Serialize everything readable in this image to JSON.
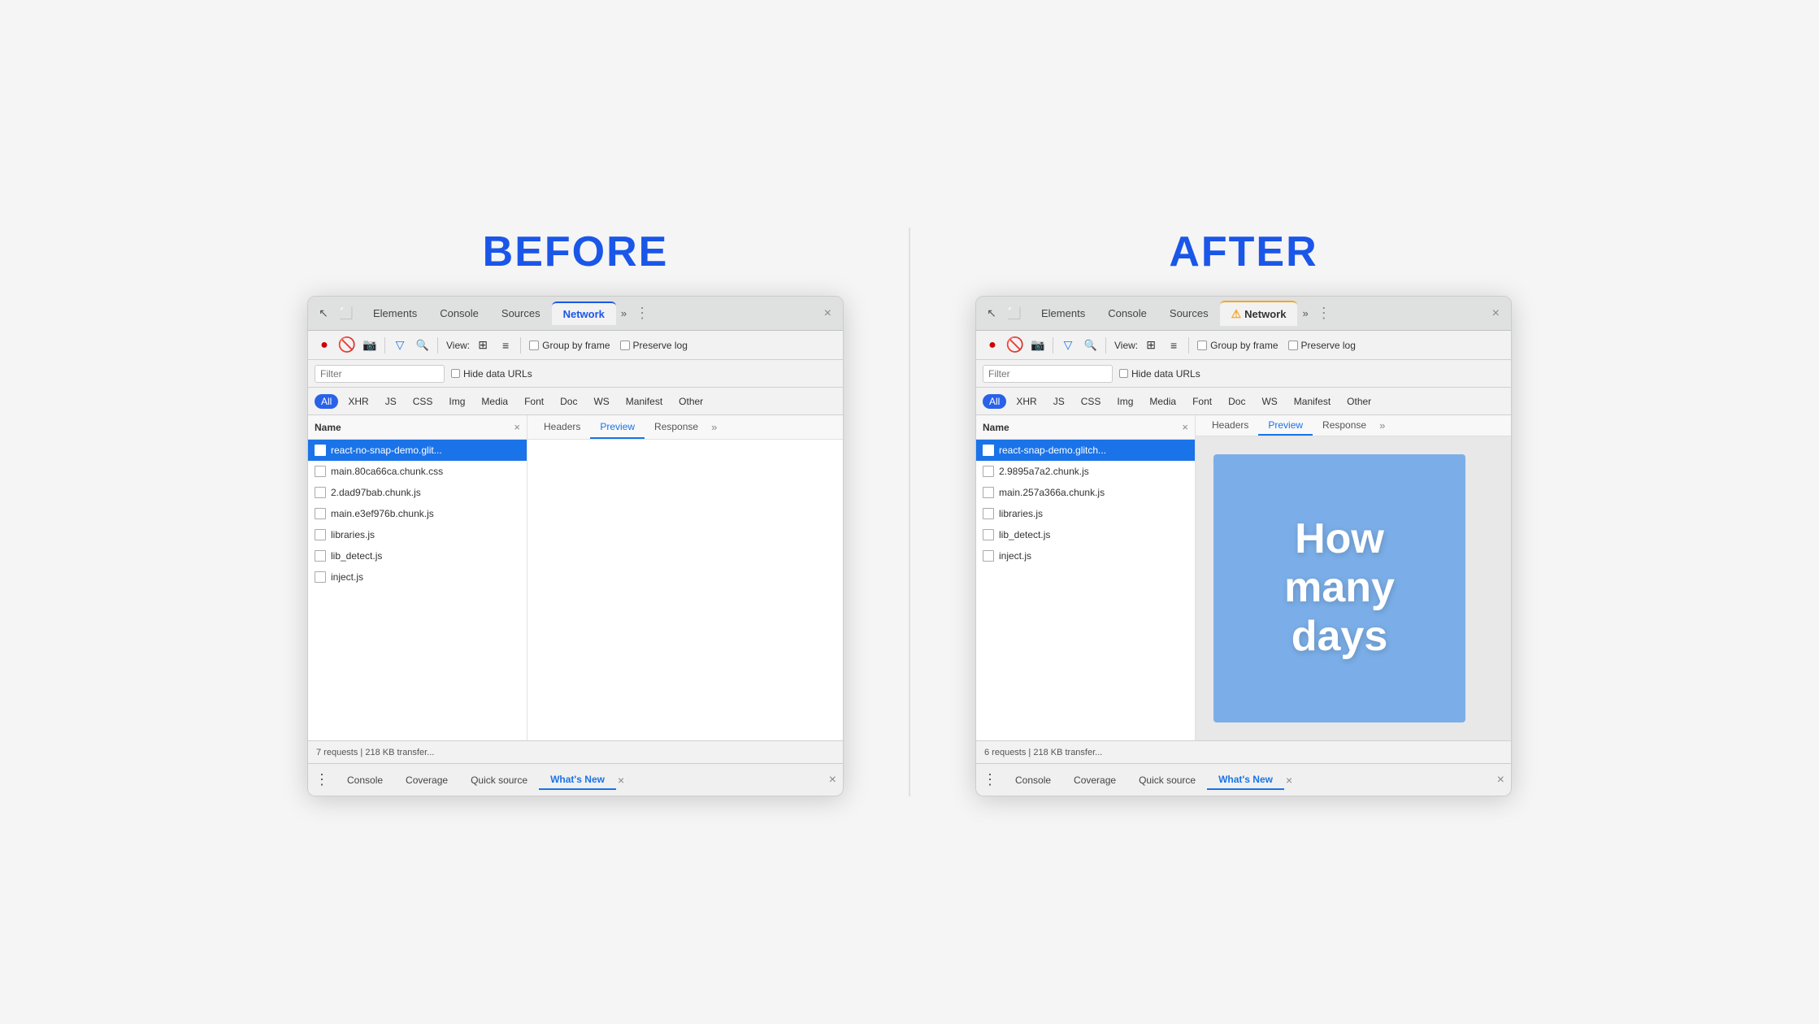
{
  "before": {
    "label": "BEFORE",
    "tabs": [
      "Elements",
      "Console",
      "Sources",
      "Network",
      "»"
    ],
    "active_tab": "Network",
    "active_tab_has_warning": false,
    "toolbar": {
      "view_label": "View:",
      "group_by_frame_label": "Group by frame",
      "preserve_log_label": "Preserve log"
    },
    "filter_placeholder": "Filter",
    "hide_data_urls": "Hide data URLs",
    "type_filters": [
      "All",
      "XHR",
      "JS",
      "CSS",
      "Img",
      "Media",
      "Font",
      "Doc",
      "WS",
      "Manifest",
      "Other"
    ],
    "active_type": "All",
    "columns": {
      "name": "Name",
      "close": "×"
    },
    "detail_tabs": [
      "Headers",
      "Preview",
      "Response",
      "»"
    ],
    "active_detail_tab": "Preview",
    "files": [
      {
        "name": "react-no-snap-demo.glit...",
        "selected": true
      },
      {
        "name": "main.80ca66ca.chunk.css",
        "selected": false
      },
      {
        "name": "2.dad97bab.chunk.js",
        "selected": false
      },
      {
        "name": "main.e3ef976b.chunk.js",
        "selected": false
      },
      {
        "name": "libraries.js",
        "selected": false
      },
      {
        "name": "lib_detect.js",
        "selected": false
      },
      {
        "name": "inject.js",
        "selected": false
      }
    ],
    "preview_empty": true,
    "status": "7 requests | 218 KB transfer...",
    "drawer_tabs": [
      "Console",
      "Coverage",
      "Quick source",
      "What's New"
    ],
    "active_drawer_tab": "What's New"
  },
  "after": {
    "label": "AFTER",
    "tabs": [
      "Elements",
      "Console",
      "Sources",
      "Network",
      "»"
    ],
    "active_tab": "Network",
    "active_tab_has_warning": true,
    "toolbar": {
      "view_label": "View:",
      "group_by_frame_label": "Group by frame",
      "preserve_log_label": "Preserve log"
    },
    "filter_placeholder": "Filter",
    "hide_data_urls": "Hide data URLs",
    "type_filters": [
      "All",
      "XHR",
      "JS",
      "CSS",
      "Img",
      "Media",
      "Font",
      "Doc",
      "WS",
      "Manifest",
      "Other"
    ],
    "active_type": "All",
    "columns": {
      "name": "Name",
      "close": "×"
    },
    "detail_tabs": [
      "Headers",
      "Preview",
      "Response",
      "»"
    ],
    "active_detail_tab": "Preview",
    "files": [
      {
        "name": "react-snap-demo.glitch...",
        "selected": true
      },
      {
        "name": "2.9895a7a2.chunk.js",
        "selected": false
      },
      {
        "name": "main.257a366a.chunk.js",
        "selected": false
      },
      {
        "name": "libraries.js",
        "selected": false
      },
      {
        "name": "lib_detect.js",
        "selected": false
      },
      {
        "name": "inject.js",
        "selected": false
      }
    ],
    "preview_text": "How\nmany\ndays",
    "preview_empty": false,
    "status": "6 requests | 218 KB transfer...",
    "drawer_tabs": [
      "Console",
      "Coverage",
      "Quick source",
      "What's New"
    ],
    "active_drawer_tab": "What's New"
  },
  "icons": {
    "record": "●",
    "stop": "🚫",
    "camera": "📷",
    "filter": "⧩",
    "search": "🔍",
    "grid": "⊞",
    "list": "≡",
    "more": "»",
    "close": "×",
    "menu": "⋮",
    "cursor": "↖",
    "panel": "⬜"
  }
}
